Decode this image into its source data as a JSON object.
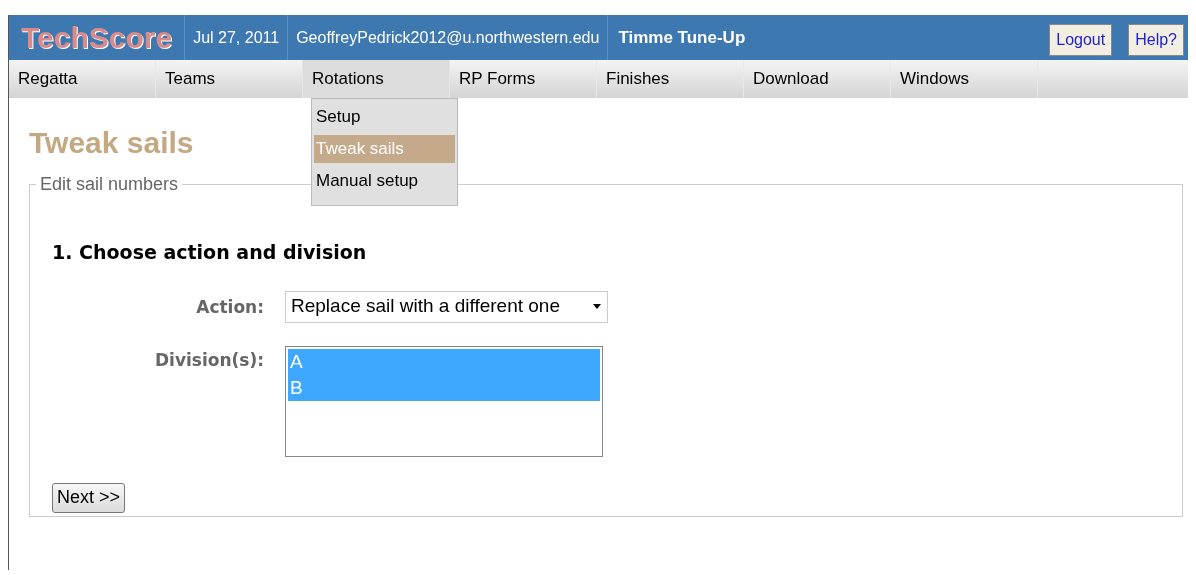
{
  "header": {
    "logo": "TechScore",
    "date": "Jul 27, 2011",
    "user": "GeoffreyPedrick2012@u.northwestern.edu",
    "regatta": "Timme Tune-Up",
    "buttons": [
      "Logout",
      "Help?"
    ]
  },
  "menu": [
    {
      "label": "Regatta",
      "selected": false
    },
    {
      "label": "Teams",
      "selected": false
    },
    {
      "label": "Rotations",
      "selected": true,
      "submenu": [
        {
          "label": "Setup",
          "selected": false
        },
        {
          "label": "Tweak sails",
          "selected": true
        },
        {
          "label": "Manual setup",
          "selected": false
        }
      ]
    },
    {
      "label": "RP Forms",
      "selected": false
    },
    {
      "label": "Finishes",
      "selected": false
    },
    {
      "label": "Download",
      "selected": false
    },
    {
      "label": "Windows",
      "selected": false
    }
  ],
  "page_title": "Tweak sails",
  "fieldset": {
    "legend": "Edit sail numbers",
    "heading": "1. Choose action and division",
    "action": {
      "label": "Action:",
      "value": "Replace sail with a different one"
    },
    "divisions": {
      "label": "Division(s):",
      "options": [
        {
          "label": "A",
          "selected": true
        },
        {
          "label": "B",
          "selected": true
        }
      ]
    },
    "submit": "Next >>"
  }
}
